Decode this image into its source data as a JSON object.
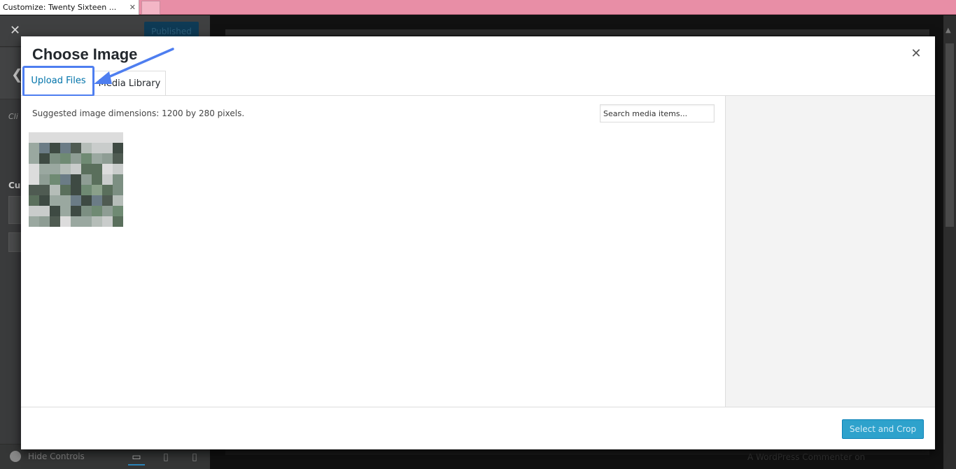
{
  "browser": {
    "tab_title": "Customize: Twenty Sixteen ...",
    "tab_close": "✕"
  },
  "customizer": {
    "close_glyph": "✕",
    "publish_label": "Published",
    "back_glyph": "❮",
    "description_fragment": "Cli fro an — up",
    "section_label": "Cu",
    "hide_controls_label": "Hide Controls",
    "devices": [
      "desktop-icon",
      "tablet-icon",
      "mobile-icon"
    ]
  },
  "preview": {
    "footer_text": "A WordPress Commenter on"
  },
  "modal": {
    "title": "Choose Image",
    "close_glyph": "✕",
    "tabs": {
      "upload": "Upload Files",
      "library": "Media Library"
    },
    "suggested_dimensions": "Suggested image dimensions: 1200 by 280 pixels.",
    "search_placeholder": "Search media items...",
    "select_button": "Select and Crop",
    "annotation_color": "#4e7ef0",
    "primary_color": "#2ea2cc"
  }
}
